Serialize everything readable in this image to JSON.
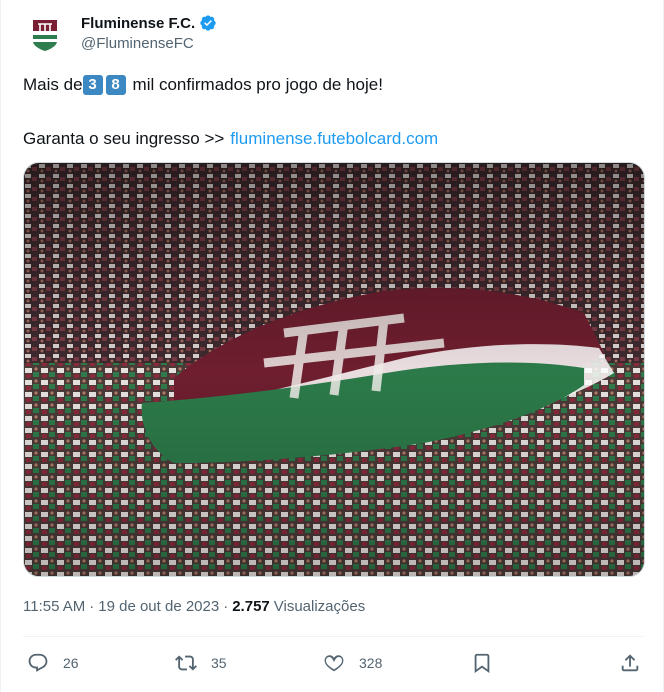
{
  "author": {
    "display_name": "Fluminense F.C.",
    "handle": "@FluminenseFC",
    "verified": true,
    "verified_color": "#1d9bf0"
  },
  "tweet": {
    "text_before_keycaps": "Mais de",
    "keycap_digits": [
      "3",
      "8"
    ],
    "text_after_keycaps": "mil confirmados pro jogo de hoje!",
    "cta_text": "Garanta o seu ingresso >>",
    "link_text": "fluminense.futebolcard.com"
  },
  "media": {
    "alt_icon": "stadium-crowd-flag-image"
  },
  "meta": {
    "time": "11:55 AM",
    "date": "19 de out de 2023",
    "separator": "·",
    "views_count": "2.757",
    "views_label": "Visualizações"
  },
  "actions": {
    "reply_count": "26",
    "retweet_count": "35",
    "like_count": "328"
  },
  "colors": {
    "link": "#1d9bf0",
    "secondary_text": "#536471",
    "keycap": "#3b88c3",
    "grena": "#7a1f33",
    "green": "#2e7d4f"
  }
}
